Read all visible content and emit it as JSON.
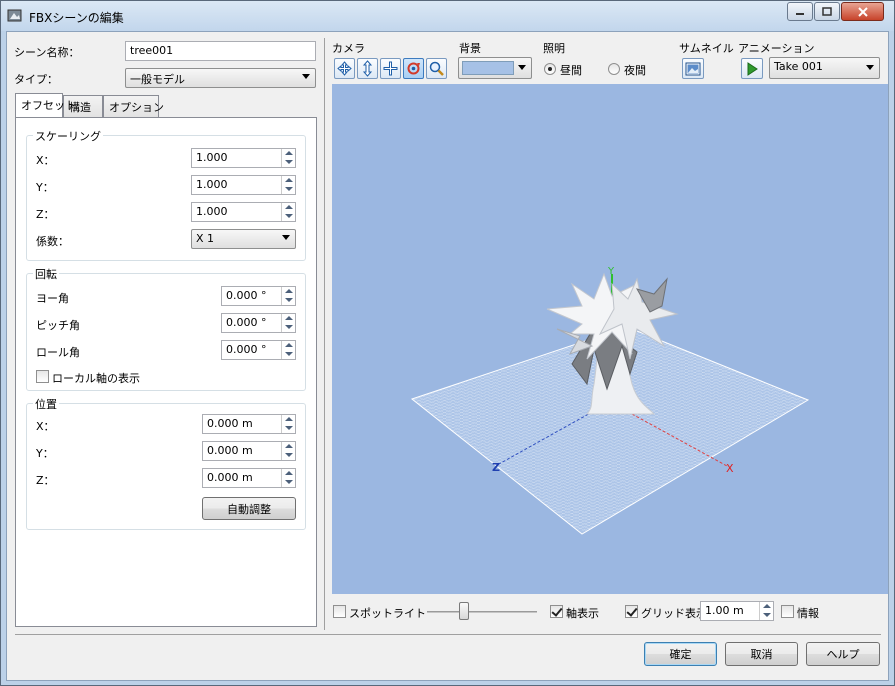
{
  "window": {
    "title": "FBXシーンの編集"
  },
  "scene": {
    "name_label": "シーン名称：",
    "name_value": "tree001",
    "type_label": "タイプ：",
    "type_value": "一般モデル"
  },
  "tabs": [
    "オフセット",
    "構造",
    "オプション"
  ],
  "scaling": {
    "label": "スケーリング",
    "x_label": "X：",
    "x": "1.000",
    "y_label": "Y：",
    "y": "1.000",
    "z_label": "Z：",
    "z": "1.000",
    "factor_label": "係数：",
    "factor_value": "X 1"
  },
  "rotation": {
    "label": "回転",
    "yaw_label": "ヨー角",
    "yaw": "0.000 °",
    "pitch_label": "ピッチ角",
    "pitch": "0.000 °",
    "roll_label": "ロール角",
    "roll": "0.000 °",
    "local_axis_label": "ローカル軸の表示",
    "local_axis_checked": false
  },
  "position": {
    "label": "位置",
    "x_label": "X：",
    "x": "0.000 m",
    "y_label": "Y：",
    "y": "0.000 m",
    "z_label": "Z：",
    "z": "0.000 m",
    "auto_button": "自動調整"
  },
  "toolbar": {
    "camera_label": "カメラ",
    "background_label": "背景",
    "background_color": "#a6c1e6",
    "lighting_label": "照明",
    "daytime": "昼間",
    "night": "夜間",
    "lighting_selected": "daytime",
    "thumbnail_label": "サムネイル",
    "animation_label": "アニメーション",
    "animation_take": "Take 001"
  },
  "camera_icons": [
    "rotate-icon",
    "move-updown-icon",
    "pan-icon",
    "orbit-icon",
    "zoom-icon"
  ],
  "viewport": {
    "background": "#9bb7e1",
    "axis_y": "Y",
    "axis_x": "X",
    "axis_z": "Z"
  },
  "bottom": {
    "spotlight_label": "スポットライト",
    "spotlight_checked": false,
    "slider_value": 0.2,
    "axis_display_label": "軸表示",
    "axis_display_checked": true,
    "grid_display_label": "グリッド表示",
    "grid_display_checked": true,
    "grid_size": "1.00 m",
    "info_label": "情報",
    "info_checked": false
  },
  "buttons": {
    "ok": "確定",
    "cancel": "取消",
    "help": "ヘルプ"
  }
}
